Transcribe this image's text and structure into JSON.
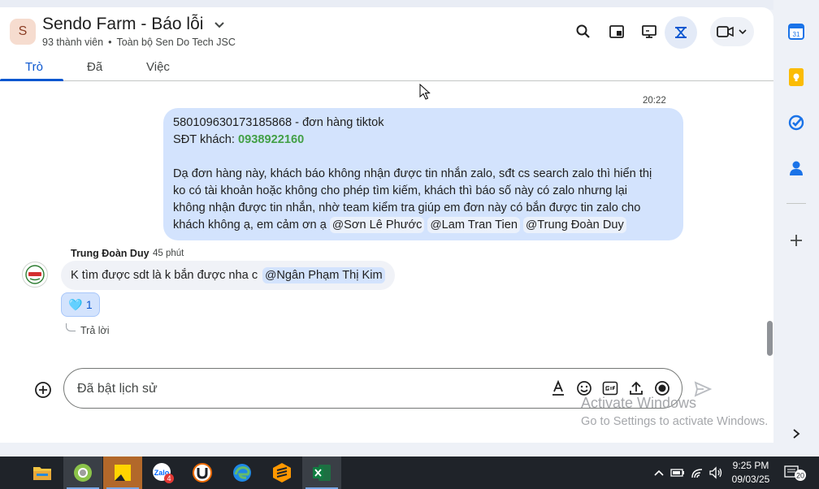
{
  "header": {
    "avatar_letter": "S",
    "title": "Sendo Farm - Báo lỗi",
    "members": "93 thành viên",
    "org": "Toàn bộ Sen Do Tech JSC",
    "separator": "•"
  },
  "tabs": [
    {
      "label": "Trò",
      "active": true
    },
    {
      "label": "Đã",
      "active": false
    },
    {
      "label": "Việc",
      "active": false
    }
  ],
  "messages": {
    "own": {
      "time": "20:22",
      "line1": "580109630173185868 - đơn hàng tiktok",
      "phone_label": "SĐT khách: ",
      "phone": "0938922160",
      "body_lines": [
        "Dạ đơn hàng này, khách báo không nhận được tin nhắn zalo, sđt cs search zalo thì hiển thị",
        "ko có tài khoản hoặc không cho phép tìm kiếm, khách thì báo số này có zalo nhưng lại",
        "không nhận được tin nhắn, nhờ team kiểm tra giúp em đơn này có bắn được tin zalo cho"
      ],
      "last_line": "khách không ạ, em cảm ơn ạ",
      "mentions": [
        "Sơn Lê Phước",
        "Lam Tran Tien",
        "Trung Đoàn Duy"
      ]
    },
    "reply": {
      "sender": "Trung Đoàn Duy",
      "time": "45 phút",
      "text": "K tìm được sdt là k bắn được nha c",
      "mention": "Ngân Phạm Thị Kim",
      "reaction_emoji": "🩵",
      "reaction_count": "1",
      "reply_label": "Trả lời"
    }
  },
  "composer": {
    "placeholder": "Đã bật lịch sử"
  },
  "watermark": {
    "title": "Activate Windows",
    "subtitle": "Go to Settings to activate Windows."
  },
  "taskbar": {
    "time": "9:25 PM",
    "date": "09/03/25",
    "notification_count": "20",
    "zalo_badge": "4"
  },
  "colors": {
    "accent": "#0b57d0",
    "bubble": "#d3e3fd",
    "phone": "#43a047"
  }
}
